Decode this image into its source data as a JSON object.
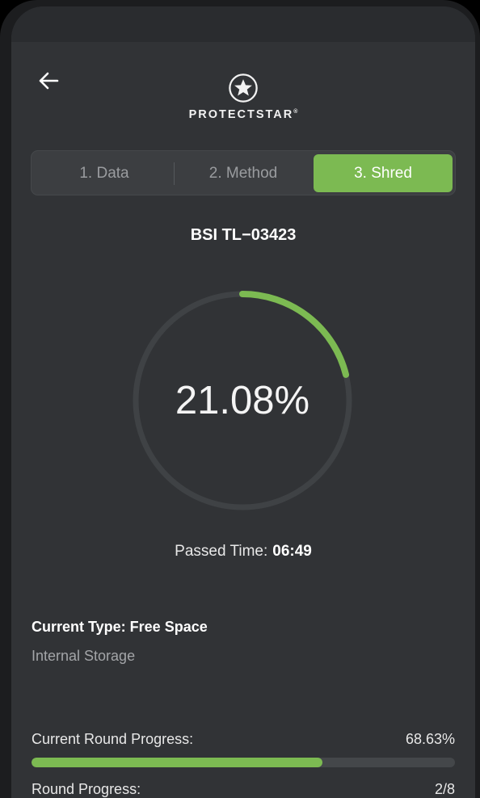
{
  "app": {
    "brand": "PROTECTSTAR",
    "trademark": "®"
  },
  "colors": {
    "accent": "#7cba52",
    "background": "#313336",
    "track": "#3f4245"
  },
  "icons": {
    "back": "arrow-left-icon",
    "logo": "star-badge-icon"
  },
  "stepper": {
    "steps": [
      {
        "label": "1. Data",
        "active": false
      },
      {
        "label": "2. Method",
        "active": false
      },
      {
        "label": "3. Shred",
        "active": true
      }
    ]
  },
  "shred": {
    "method_name": "BSI TL−03423",
    "overall_percent_text": "21.08%",
    "overall_percent": 21.08,
    "passed_time_label": "Passed Time:",
    "passed_time_value": "06:49",
    "current_type": "Current Type: Free Space",
    "storage": "Internal Storage",
    "current_round_label": "Current Round Progress:",
    "current_round_value": "68.63%",
    "current_round_fraction": 0.6863,
    "round_label": "Round Progress:",
    "round_value": "2/8"
  }
}
